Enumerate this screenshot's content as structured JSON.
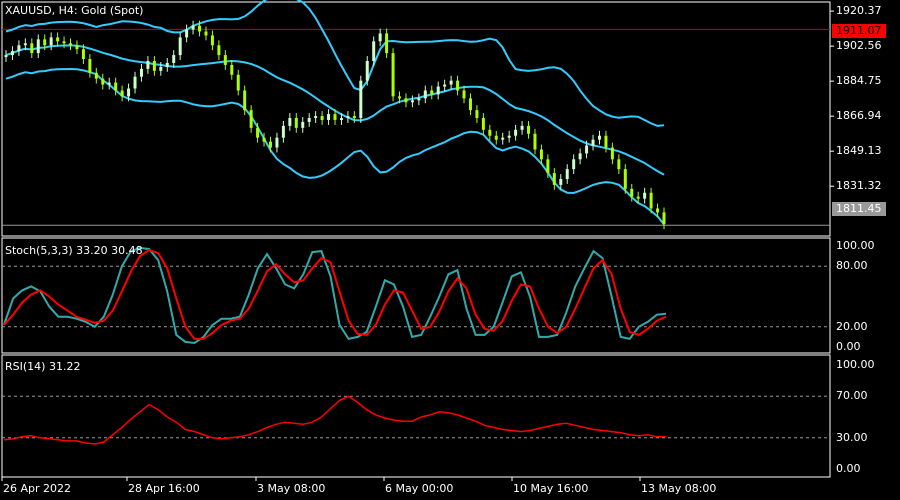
{
  "chart_data": {
    "type": "candlestick",
    "title": "XAUUSD, H4:  Gold (Spot)",
    "colors": {
      "background": "#000000",
      "bull_candle": "#ccffcc",
      "bear_candle": "#aaff00",
      "bollinger": "#33ccff",
      "stoch_main": "#33aaaa",
      "stoch_signal": "#ff0000",
      "rsi": "#ff0000",
      "hline_red": "#cc0000",
      "hline_gray": "#999999",
      "price_box_red": "#ff0000",
      "price_box_gray": "#999999"
    },
    "price_axis": {
      "ticks": [
        "1920.37",
        "1902.56",
        "1884.75",
        "1866.94",
        "1849.13",
        "1831.32"
      ],
      "range": [
        1806,
        1925
      ]
    },
    "horizontal_lines": [
      {
        "price": 1911.07,
        "label": "1911.07",
        "color": "red"
      },
      {
        "price": 1811.45,
        "label": "1811.45",
        "color": "gray"
      }
    ],
    "x_axis_labels": [
      "26 Apr 2022",
      "28 Apr 16:00",
      "3 May 08:00",
      "6 May 00:00",
      "10 May 16:00",
      "13 May 08:00"
    ],
    "candles_close": [
      1898,
      1900,
      1903,
      1904,
      1899,
      1906,
      1903,
      1907,
      1905,
      1904,
      1903,
      1901,
      1896,
      1889,
      1886,
      1883,
      1884,
      1880,
      1877,
      1881,
      1887,
      1891,
      1895,
      1890,
      1892,
      1894,
      1898,
      1907,
      1911,
      1913,
      1910,
      1908,
      1903,
      1898,
      1893,
      1888,
      1880,
      1870,
      1861,
      1856,
      1854,
      1851,
      1856,
      1862,
      1866,
      1861,
      1864,
      1866,
      1867,
      1865,
      1868,
      1865,
      1866,
      1867,
      1866,
      1885,
      1895,
      1905,
      1909,
      1899,
      1877,
      1876,
      1874,
      1875,
      1876,
      1880,
      1878,
      1882,
      1883,
      1885,
      1880,
      1876,
      1870,
      1866,
      1860,
      1857,
      1855,
      1856,
      1857,
      1860,
      1862,
      1858,
      1850,
      1845,
      1838,
      1832,
      1835,
      1840,
      1845,
      1848,
      1852,
      1855,
      1857,
      1851,
      1845,
      1840,
      1830,
      1826,
      1825,
      1828,
      1820,
      1818,
      1812
    ],
    "stochastic": {
      "label": "Stoch(5,3,3) 33.20 30.48",
      "levels": [
        20,
        80
      ],
      "ticks": [
        "100.00",
        "80.00",
        "20.00",
        "0.00"
      ],
      "main": [
        22,
        48,
        56,
        60,
        55,
        40,
        30,
        30,
        28,
        25,
        20,
        30,
        52,
        80,
        95,
        98,
        97,
        86,
        55,
        12,
        5,
        4,
        10,
        22,
        28,
        28,
        30,
        52,
        78,
        92,
        78,
        62,
        58,
        72,
        94,
        95,
        70,
        22,
        8,
        10,
        15,
        40,
        66,
        62,
        40,
        10,
        12,
        30,
        50,
        72,
        76,
        38,
        12,
        12,
        20,
        45,
        70,
        74,
        50,
        10,
        10,
        12,
        34,
        60,
        78,
        95,
        88,
        50,
        10,
        8,
        20,
        25,
        32,
        33
      ],
      "signal": [
        22,
        32,
        44,
        52,
        56,
        50,
        42,
        36,
        30,
        27,
        24,
        26,
        36,
        55,
        75,
        90,
        96,
        93,
        78,
        48,
        20,
        8,
        8,
        14,
        22,
        26,
        28,
        38,
        56,
        75,
        82,
        72,
        64,
        66,
        78,
        88,
        84,
        55,
        26,
        13,
        12,
        22,
        42,
        56,
        54,
        36,
        18,
        20,
        35,
        55,
        68,
        58,
        32,
        18,
        16,
        26,
        46,
        62,
        60,
        38,
        20,
        14,
        20,
        38,
        58,
        78,
        86,
        72,
        38,
        15,
        12,
        18,
        26,
        30
      ]
    },
    "rsi": {
      "label": "RSI(14) 31.22",
      "levels": [
        30,
        70
      ],
      "ticks": [
        "100.00",
        "70.00",
        "30.00",
        "0.00"
      ],
      "values": [
        28,
        29,
        31,
        32,
        30,
        29,
        28,
        27,
        27,
        25,
        24,
        26,
        33,
        40,
        48,
        55,
        62,
        57,
        50,
        45,
        38,
        36,
        33,
        30,
        29,
        30,
        31,
        33,
        36,
        40,
        43,
        45,
        44,
        43,
        45,
        50,
        58,
        66,
        70,
        64,
        57,
        52,
        49,
        47,
        46,
        46,
        50,
        52,
        55,
        54,
        52,
        49,
        46,
        42,
        40,
        38,
        37,
        36,
        37,
        39,
        41,
        43,
        44,
        42,
        40,
        38,
        37,
        36,
        35,
        33,
        32,
        33,
        31,
        31
      ]
    }
  }
}
